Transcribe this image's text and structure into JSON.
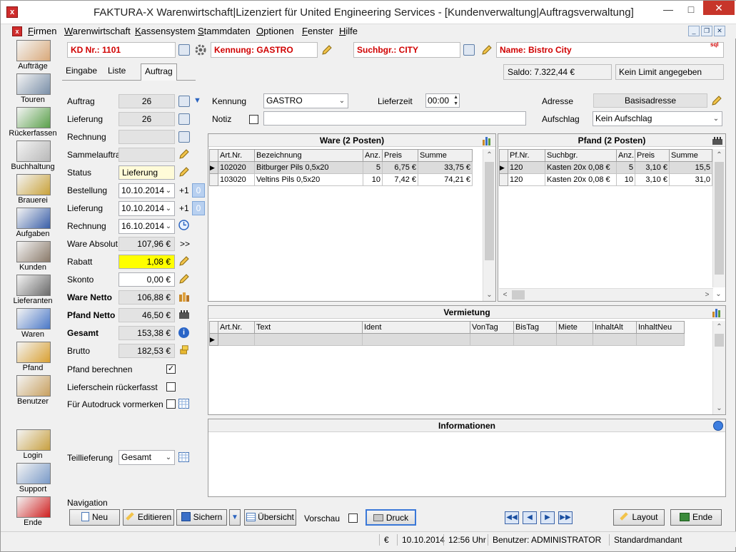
{
  "window": {
    "title": "FAKTURA-X Warenwirtschaft|Lizenziert für United Engineering Services - [Kundenverwaltung|Auftragsverwaltung]"
  },
  "menu": [
    {
      "label": "Firmen",
      "u": "F",
      "rest": "irmen"
    },
    {
      "label": "Warenwirtschaft",
      "u": "W",
      "rest": "arenwirtschaft"
    },
    {
      "label": "Kassensystem",
      "u": "K",
      "rest": "assensystem"
    },
    {
      "label": "Stammdaten",
      "u": "S",
      "rest": "tammdaten"
    },
    {
      "label": "Optionen",
      "u": "O",
      "rest": "ptionen"
    },
    {
      "label": "Fenster",
      "u": "F",
      "rest": "enster"
    },
    {
      "label": "Hilfe",
      "u": "H",
      "rest": "ilfe"
    }
  ],
  "sidebar": [
    "Aufträge",
    "Touren",
    "Rückerfassen",
    "Buchhaltung",
    "Brauerei",
    "Aufgaben",
    "Kunden",
    "Lieferanten",
    "Waren",
    "Pfand",
    "Benutzer",
    "Login",
    "Support",
    "Ende"
  ],
  "header": {
    "kd_nr": "KD Nr.: 1101",
    "kennung": "Kennung: GASTRO",
    "suchbgr": "Suchbgr.: CITY",
    "name": "Name: Bistro City",
    "sql_badge": "sql"
  },
  "tabs": [
    "Eingabe",
    "Liste",
    "Auftrag"
  ],
  "saldo": "Saldo: 7.322,44 €",
  "limit": "Kein Limit angegeben",
  "form": {
    "auftrag_label": "Auftrag",
    "auftrag": "26",
    "lieferung_label": "Lieferung",
    "lieferung": "26",
    "rechnung_label": "Rechnung",
    "rechnung": "",
    "sammelauftrag_label": "Sammelauftrag",
    "sammelauftrag": "",
    "status_label": "Status",
    "status": "Lieferung",
    "bestellung_label": "Bestellung",
    "bestellung_date": "10.10.2014",
    "bestellung_plus": "+1",
    "bestellung_count": "0",
    "lieferung2_label": "Lieferung",
    "lieferung_date": "10.10.2014",
    "lieferung_plus": "+1",
    "lieferung_count": "0",
    "rechnung2_label": "Rechnung",
    "rechnung_date": "16.10.2014",
    "ware_absolut_label": "Ware Absolut",
    "ware_absolut": "107,96 €",
    "ware_absolut_arrow": ">>",
    "rabatt_label": "Rabatt",
    "rabatt": "1,08 €",
    "skonto_label": "Skonto",
    "skonto": "0,00 €",
    "ware_netto_label": "Ware Netto",
    "ware_netto": "106,88 €",
    "pfand_netto_label": "Pfand Netto",
    "pfand_netto": "46,50 €",
    "gesamt_label": "Gesamt",
    "gesamt": "153,38 €",
    "brutto_label": "Brutto",
    "brutto": "182,53 €",
    "pfand_berechnen": "Pfand berechnen",
    "lieferschein": "Lieferschein rückerfasst",
    "autodruck": "Für Autodruck vormerken",
    "teillieferung_label": "Teillieferung",
    "teillieferung": "Gesamt"
  },
  "topfields": {
    "kennung_label": "Kennung",
    "kennung": "GASTRO",
    "lieferzeit_label": "Lieferzeit",
    "lieferzeit": "00:00",
    "adresse_label": "Adresse",
    "adresse": "Basisadresse",
    "notiz_label": "Notiz",
    "notiz": "",
    "aufschlag_label": "Aufschlag",
    "aufschlag": "Kein Aufschlag"
  },
  "ware": {
    "title": "Ware (2 Posten)",
    "columns": [
      "Art.Nr.",
      "Bezeichnung",
      "Anz.",
      "Preis",
      "Summe"
    ],
    "rows": [
      {
        "artnr": "102020",
        "bez": "Bitburger Pils 0,5x20",
        "anz": "5",
        "preis": "6,75 €",
        "summe": "33,75 €"
      },
      {
        "artnr": "103020",
        "bez": "Veltins Pils 0,5x20",
        "anz": "10",
        "preis": "7,42 €",
        "summe": "74,21 €"
      }
    ]
  },
  "pfand": {
    "title": "Pfand (2 Posten)",
    "columns": [
      "Pf.Nr.",
      "Suchbgr.",
      "Anz.",
      "Preis",
      "Summe"
    ],
    "rows": [
      {
        "nr": "120",
        "such": "Kasten 20x 0,08 €",
        "anz": "5",
        "preis": "3,10 €",
        "summe": "15,5"
      },
      {
        "nr": "120",
        "such": "Kasten 20x 0,08 €",
        "anz": "10",
        "preis": "3,10 €",
        "summe": "31,0"
      }
    ]
  },
  "vermietung": {
    "title": "Vermietung",
    "columns": [
      "Art.Nr.",
      "Text",
      "Ident",
      "VonTag",
      "BisTag",
      "Miete",
      "InhaltAlt",
      "InhaltNeu"
    ]
  },
  "informationen": {
    "title": "Informationen"
  },
  "navigation": {
    "label": "Navigation",
    "neu": "Neu",
    "editieren": "Editieren",
    "sichern": "Sichern",
    "uebersicht": "Übersicht",
    "vorschau": "Vorschau",
    "druck": "Druck",
    "layout": "Layout",
    "ende": "Ende"
  },
  "status": {
    "currency": "€",
    "date": "10.10.2014",
    "time": "12:56 Uhr",
    "user": "Benutzer: ADMINISTRATOR",
    "mandant": "Standardmandant"
  }
}
